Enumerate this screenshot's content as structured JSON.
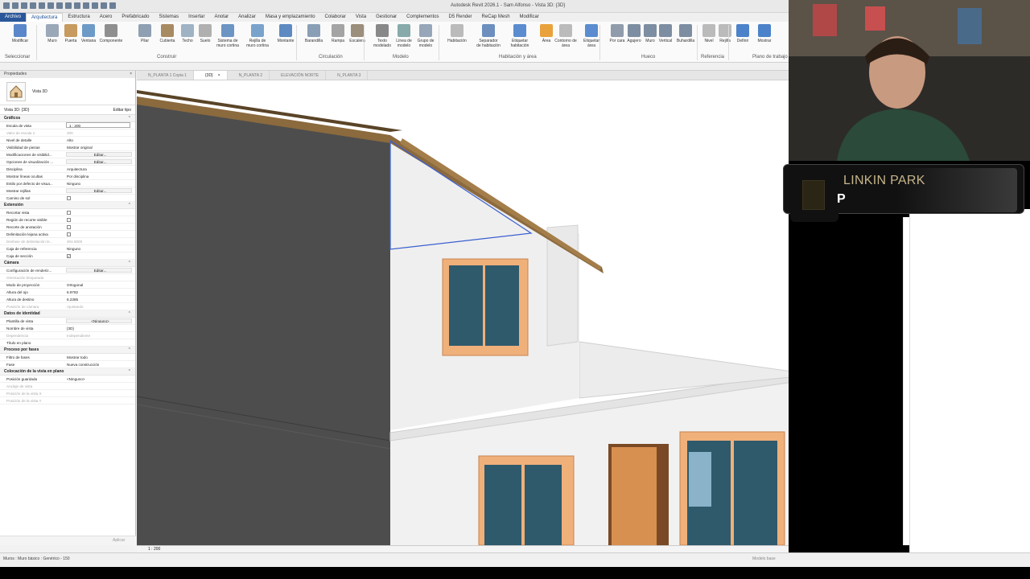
{
  "app": {
    "title": "Autodesk Revit 2026.1 - Sam Alfonso - Vista 3D: {3D}"
  },
  "menu": {
    "tabs": [
      "Archivo",
      "Arquitectura",
      "Estructura",
      "Acero",
      "Prefabricado",
      "Sistemas",
      "Insertar",
      "Anotar",
      "Analizar",
      "Masa y emplazamiento",
      "Colaborar",
      "Vista",
      "Gestionar",
      "Complementos",
      "D5 Render",
      "ReCap Mesh",
      "Modificar"
    ],
    "active": "Arquitectura"
  },
  "ribbon": {
    "tools": [
      "Modificar",
      "Muro",
      "Puerta",
      "Ventana",
      "Componente",
      "Pilar",
      "Cubierta",
      "Techo",
      "Suelo",
      "Sistema de muro cortina",
      "Rejilla de muro cortina",
      "Montante",
      "Barandilla",
      "Rampa",
      "Escalera",
      "Texto modelado",
      "Línea de modelo",
      "Grupo de modelo",
      "Habitación",
      "Separador de habitación",
      "Etiquetar habitación",
      "Área",
      "Contorno de área",
      "Etiquetar área",
      "Por cara",
      "Agujero",
      "Muro",
      "Vertical",
      "Buhardilla",
      "Nivel",
      "Rejilla",
      "Definir",
      "Mostrar"
    ],
    "groups": [
      "Seleccionar",
      "Construir",
      "Circulación",
      "Modelo",
      "Habitación y área",
      "Hueco",
      "Referencia",
      "Plano de trabajo"
    ]
  },
  "properties": {
    "header": "Propiedades",
    "type_name": "Vista 3D",
    "selector": "Vista 3D: {3D}",
    "edit_type": "Editar tipo",
    "groups": [
      {
        "name": "Gráficos",
        "rows": [
          {
            "k": "Escala de vista",
            "v": "1 : 200",
            "kind": "input"
          },
          {
            "k": "Valor de escala 1:",
            "v": "200",
            "dim": true
          },
          {
            "k": "Nivel de detalle",
            "v": "Alto"
          },
          {
            "k": "Visibilidad de piezas",
            "v": "Mostrar original"
          },
          {
            "k": "Modificaciones de visibilid...",
            "v": "Editar...",
            "kind": "btn"
          },
          {
            "k": "Opciones de visualización ...",
            "v": "Editar...",
            "kind": "btn"
          },
          {
            "k": "Disciplina",
            "v": "Arquitectura"
          },
          {
            "k": "Mostrar líneas ocultas",
            "v": "Por disciplina"
          },
          {
            "k": "Estilo por defecto de visua...",
            "v": "Ninguno"
          },
          {
            "k": "Mostrar rejillas",
            "v": "Editar...",
            "kind": "btn"
          },
          {
            "k": "Camino de sol",
            "v": "",
            "kind": "check"
          }
        ]
      },
      {
        "name": "Extensión",
        "rows": [
          {
            "k": "Recortar vista",
            "v": "",
            "kind": "check"
          },
          {
            "k": "Región de recorte visible",
            "v": "",
            "kind": "check"
          },
          {
            "k": "Recorte de anotación",
            "v": "",
            "kind": "check"
          },
          {
            "k": "Delimitación lejana activa",
            "v": "",
            "kind": "check"
          },
          {
            "k": "Desfase de delimitación le...",
            "v": "304.8000",
            "dim": true
          },
          {
            "k": "Caja de referencia",
            "v": "Ninguno"
          },
          {
            "k": "Caja de sección",
            "v": "✓",
            "kind": "check"
          }
        ]
      },
      {
        "name": "Cámara",
        "rows": [
          {
            "k": "Configuración de renderiz...",
            "v": "Editar...",
            "kind": "btn"
          },
          {
            "k": "Orientación bloqueada",
            "v": "",
            "dim": true
          },
          {
            "k": "Modo de proyección",
            "v": "Ortogonal"
          },
          {
            "k": "Altura del ojo",
            "v": "6.9782"
          },
          {
            "k": "Altura de destino",
            "v": "6.2385"
          },
          {
            "k": "Posición de cámara",
            "v": "Ajustando",
            "dim": true
          }
        ]
      },
      {
        "name": "Datos de identidad",
        "rows": [
          {
            "k": "Plantilla de vista",
            "v": "<Ninguno>",
            "kind": "btn"
          },
          {
            "k": "Nombre de vista",
            "v": "{3D}"
          },
          {
            "k": "Dependencia",
            "v": "Independiente",
            "dim": true
          },
          {
            "k": "Título en plano",
            "v": ""
          }
        ]
      },
      {
        "name": "Proceso por fases",
        "rows": [
          {
            "k": "Filtro de fases",
            "v": "Mostrar todo"
          },
          {
            "k": "Fase",
            "v": "Nueva construcción"
          }
        ]
      },
      {
        "name": "Colocación de la vista en plano",
        "rows": [
          {
            "k": "Posición guardada",
            "v": "<Ninguno>"
          },
          {
            "k": "Anclaje de vista",
            "v": "",
            "dim": true
          },
          {
            "k": "Posición de la vista X",
            "v": "",
            "dim": true
          },
          {
            "k": "Posición de la vista Y",
            "v": "",
            "dim": true
          }
        ]
      }
    ],
    "apply": "Aplicar"
  },
  "view_tabs": [
    {
      "label": "N_PLANTA 1 Copia 1",
      "active": false,
      "closable": false
    },
    {
      "label": "{3D}",
      "active": true,
      "closable": true
    },
    {
      "label": "N_PLANTA 2",
      "active": false,
      "closable": false
    },
    {
      "label": "ELEVACIÓN NORTE",
      "active": false,
      "closable": false
    },
    {
      "label": "N_PLANTA 3",
      "active": false,
      "closable": false
    }
  ],
  "viewbar": {
    "scale": "1 : 200"
  },
  "status": {
    "message": "Muros : Muro básico : Genérico - 150",
    "model": "Modelo base"
  },
  "now_playing": {
    "artist": "LINKIN PARK",
    "song": "P"
  },
  "colors": {
    "ribbon_accent": "#2b579a",
    "wall": "#4d4d4d",
    "facade": "#f1f1f1",
    "frame": "#e8a872",
    "glass": "#2f5a6c",
    "roof": "#8b6a3e"
  }
}
